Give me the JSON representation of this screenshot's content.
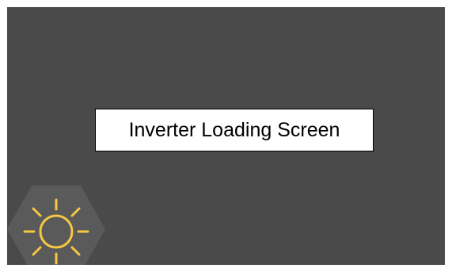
{
  "screen": {
    "title": "Inverter Loading Screen",
    "background_color": "#4a4a4a"
  },
  "badge": {
    "icon": "sun-icon",
    "hex_color": "#5a5a5a",
    "sun_color": "#f5c842"
  }
}
